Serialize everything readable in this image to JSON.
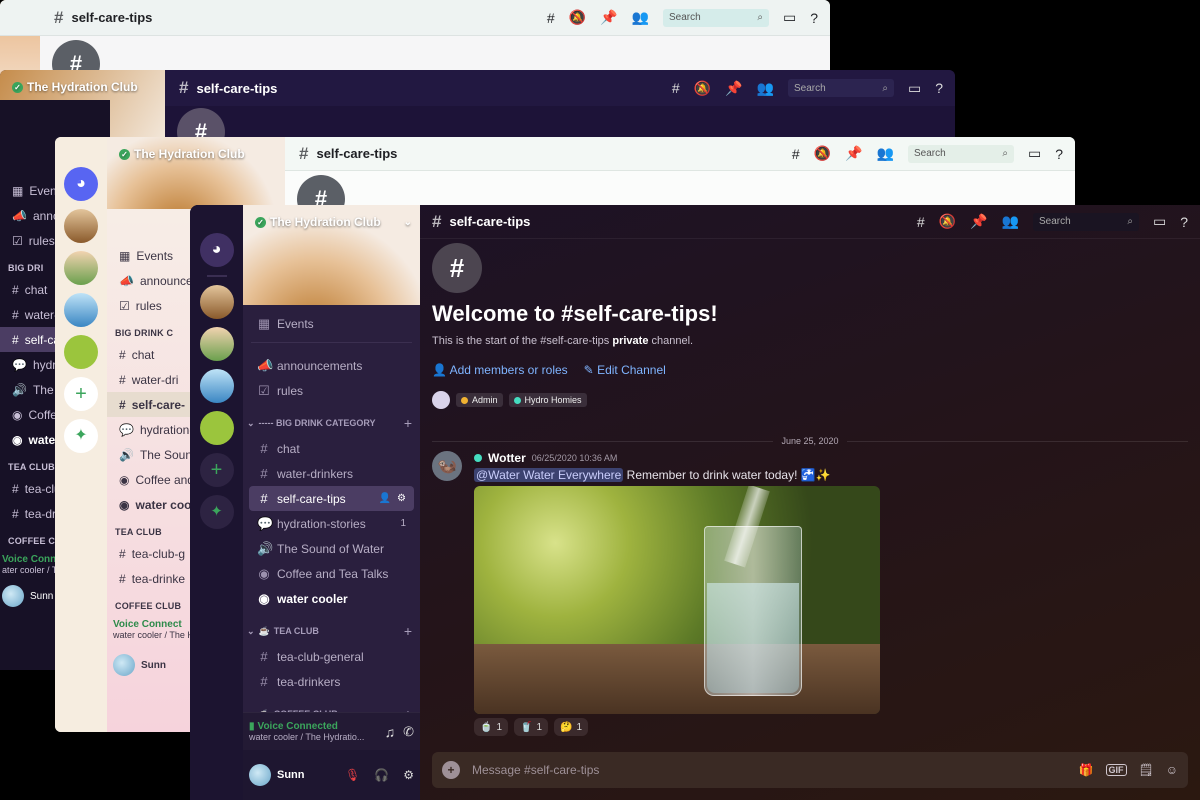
{
  "back_windows": {
    "w1": {
      "channel": "self-care-tips",
      "search_placeholder": "Search"
    },
    "w2": {
      "server": "The Hydration Club",
      "channel": "self-care-tips",
      "search_placeholder": "Search"
    },
    "w3": {
      "server": "The Hydration Club",
      "channel": "self-care-tips",
      "search_placeholder": "Search",
      "items": [
        "Events",
        "announce",
        "rules",
        "chat",
        "water-dri",
        "self-care-",
        "hydration-",
        "The Sound",
        "Coffee and",
        "water coo"
      ],
      "cat_big": "BIG DRINK C",
      "cat_tea": "TEA CLUB",
      "cat_coffee": "COFFEE CLUB",
      "tea_items": [
        "tea-club-g",
        "tea-drinke"
      ],
      "voice_status": "Voice Connect",
      "voice_sub": "water cooler / The H",
      "user": "Sunn"
    },
    "w0": {
      "items": [
        "Events",
        "announ",
        "rules",
        "chat",
        "water-c",
        "self-ca",
        "hydrati",
        "The So",
        "Coffee",
        "water c"
      ],
      "cat_big": "BIG DRI",
      "cat_tea": "TEA CLUB",
      "cat_coffee": "COFFEE CL",
      "tea_items": [
        "tea-club",
        "tea-dri"
      ],
      "voice_status": "Voice Conne",
      "voice_sub": "ater cooler / The",
      "user": "Sunn"
    }
  },
  "main": {
    "server_name": "The Hydration Club",
    "channel": "self-care-tips",
    "search_placeholder": "Search",
    "sidebar": {
      "events": "Events",
      "top_channels": [
        {
          "icon": "📣",
          "label": "announcements"
        },
        {
          "icon": "☑",
          "label": "rules"
        }
      ],
      "cat_big_drink": "----- BIG DRINK CATEGORY",
      "big_drink_channels": [
        {
          "icon": "#",
          "label": "chat"
        },
        {
          "icon": "#",
          "label": "water-drinkers"
        },
        {
          "icon": "#",
          "label": "self-care-tips"
        },
        {
          "icon": "💬",
          "label": "hydration-stories",
          "count": "1"
        },
        {
          "icon": "🔊",
          "label": "The Sound of Water"
        },
        {
          "icon": "◉",
          "label": "Coffee and Tea Talks"
        },
        {
          "icon": "◉",
          "label": "water cooler"
        }
      ],
      "cat_tea": "TEA CLUB",
      "tea_channels": [
        {
          "icon": "#",
          "label": "tea-club-general"
        },
        {
          "icon": "#",
          "label": "tea-drinkers"
        }
      ],
      "cat_coffee": "COFFEE CLUB",
      "voice_status": "Voice Connected",
      "voice_sub": "water cooler / The Hydratio...",
      "username": "Sunn"
    },
    "welcome_title": "Welcome to #self-care-tips!",
    "welcome_pre": "This is the start of the #self-care-tips ",
    "welcome_bold": "private",
    "welcome_post": " channel.",
    "add_members": "Add members or roles",
    "edit_channel": "Edit Channel",
    "roles": [
      {
        "label": "Admin",
        "color": "#f0b232"
      },
      {
        "label": "Hydro Homies",
        "color": "#45ddc0"
      }
    ],
    "date_divider": "June 25, 2020",
    "message": {
      "author": "Wotter",
      "timestamp": "06/25/2020 10:36 AM",
      "mention": "@Water Water Everywhere",
      "text": " Remember to drink water today! ",
      "emoji": "🚰✨"
    },
    "reactions": [
      {
        "emoji": "🍵",
        "count": "1"
      },
      {
        "emoji": "🥤",
        "count": "1"
      },
      {
        "emoji": "🤔",
        "count": "1"
      }
    ],
    "composer_placeholder": "Message #self-care-tips",
    "gif_label": "GIF"
  }
}
